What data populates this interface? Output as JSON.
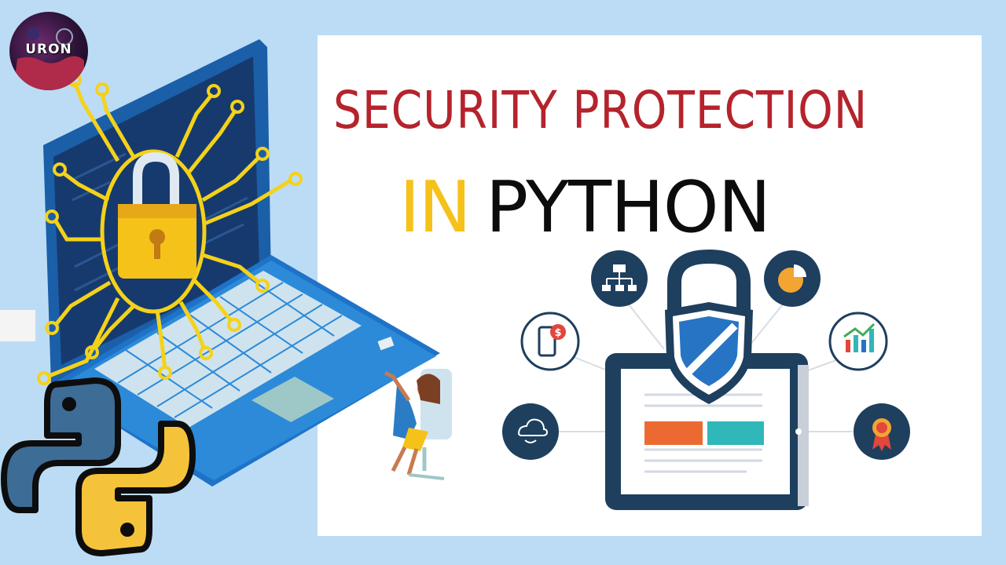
{
  "title": {
    "line1": "SECURITY PROTECTION",
    "line2_highlight": "IN",
    "line2_main": "PYTHON"
  },
  "logo": {
    "text": "URON"
  },
  "colors": {
    "background": "#bcdcf5",
    "title_red": "#b5232c",
    "title_yellow": "#f5c21a",
    "laptop_blue": "#1e73c8",
    "python_blue": "#3d6c96",
    "python_yellow": "#f5c33a",
    "circuit_gold": "#f4d21a"
  },
  "icons": {
    "network": "network-diagram-icon",
    "pie_chart": "pie-chart-icon",
    "mobile_payment": "mobile-payment-icon",
    "growth_chart": "growth-chart-icon",
    "cloud": "cloud-icon",
    "award": "award-badge-icon",
    "padlock": "padlock-icon",
    "shield": "shield-icon",
    "python": "python-logo-icon",
    "laptop": "laptop-icon"
  },
  "shield_dollar": "$"
}
